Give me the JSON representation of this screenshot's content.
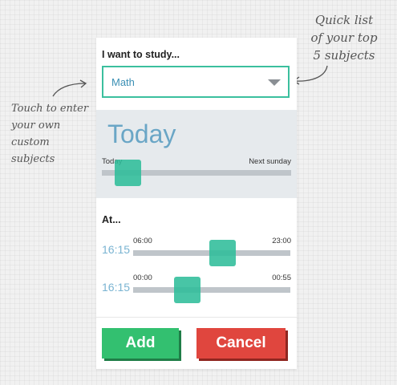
{
  "annotations": {
    "right": [
      "Quick list",
      "of your top",
      "5 subjects"
    ],
    "left": [
      "Touch to enter",
      "your own",
      "custom subjects"
    ]
  },
  "study": {
    "label": "I want to study...",
    "selected": "Math"
  },
  "day": {
    "display": "Today",
    "min_label": "Today",
    "max_label": "Next sunday",
    "position": 0.08
  },
  "at": {
    "label": "At...",
    "sliders": [
      {
        "value": "16:15",
        "min_label": "06:00",
        "max_label": "23:00",
        "position": 0.58
      },
      {
        "value": "16:15",
        "min_label": "00:00",
        "max_label": "00:55",
        "position": 0.31
      }
    ]
  },
  "buttons": {
    "add_label": "Add",
    "cancel_label": "Cancel"
  },
  "colors": {
    "accent_teal": "#2fbd9a",
    "add_green": "#33c070",
    "cancel_red": "#e0463e",
    "time_blue": "#7ab4d2"
  }
}
